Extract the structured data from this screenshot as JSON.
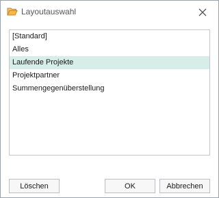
{
  "window": {
    "title": "Layoutauswahl",
    "icon": "folder-open-icon",
    "close_icon": "close-icon"
  },
  "list": {
    "items": [
      {
        "label": "[Standard]",
        "selected": false
      },
      {
        "label": "Alles",
        "selected": false
      },
      {
        "label": "Laufende Projekte",
        "selected": true
      },
      {
        "label": "Projektpartner",
        "selected": false
      },
      {
        "label": "Summengegenüberstellung",
        "selected": false
      }
    ]
  },
  "buttons": {
    "delete": "Löschen",
    "ok": "OK",
    "cancel": "Abbrechen"
  },
  "colors": {
    "selection": "#d7ede7",
    "folder": "#e8a33a",
    "border": "#9aa3ab"
  }
}
